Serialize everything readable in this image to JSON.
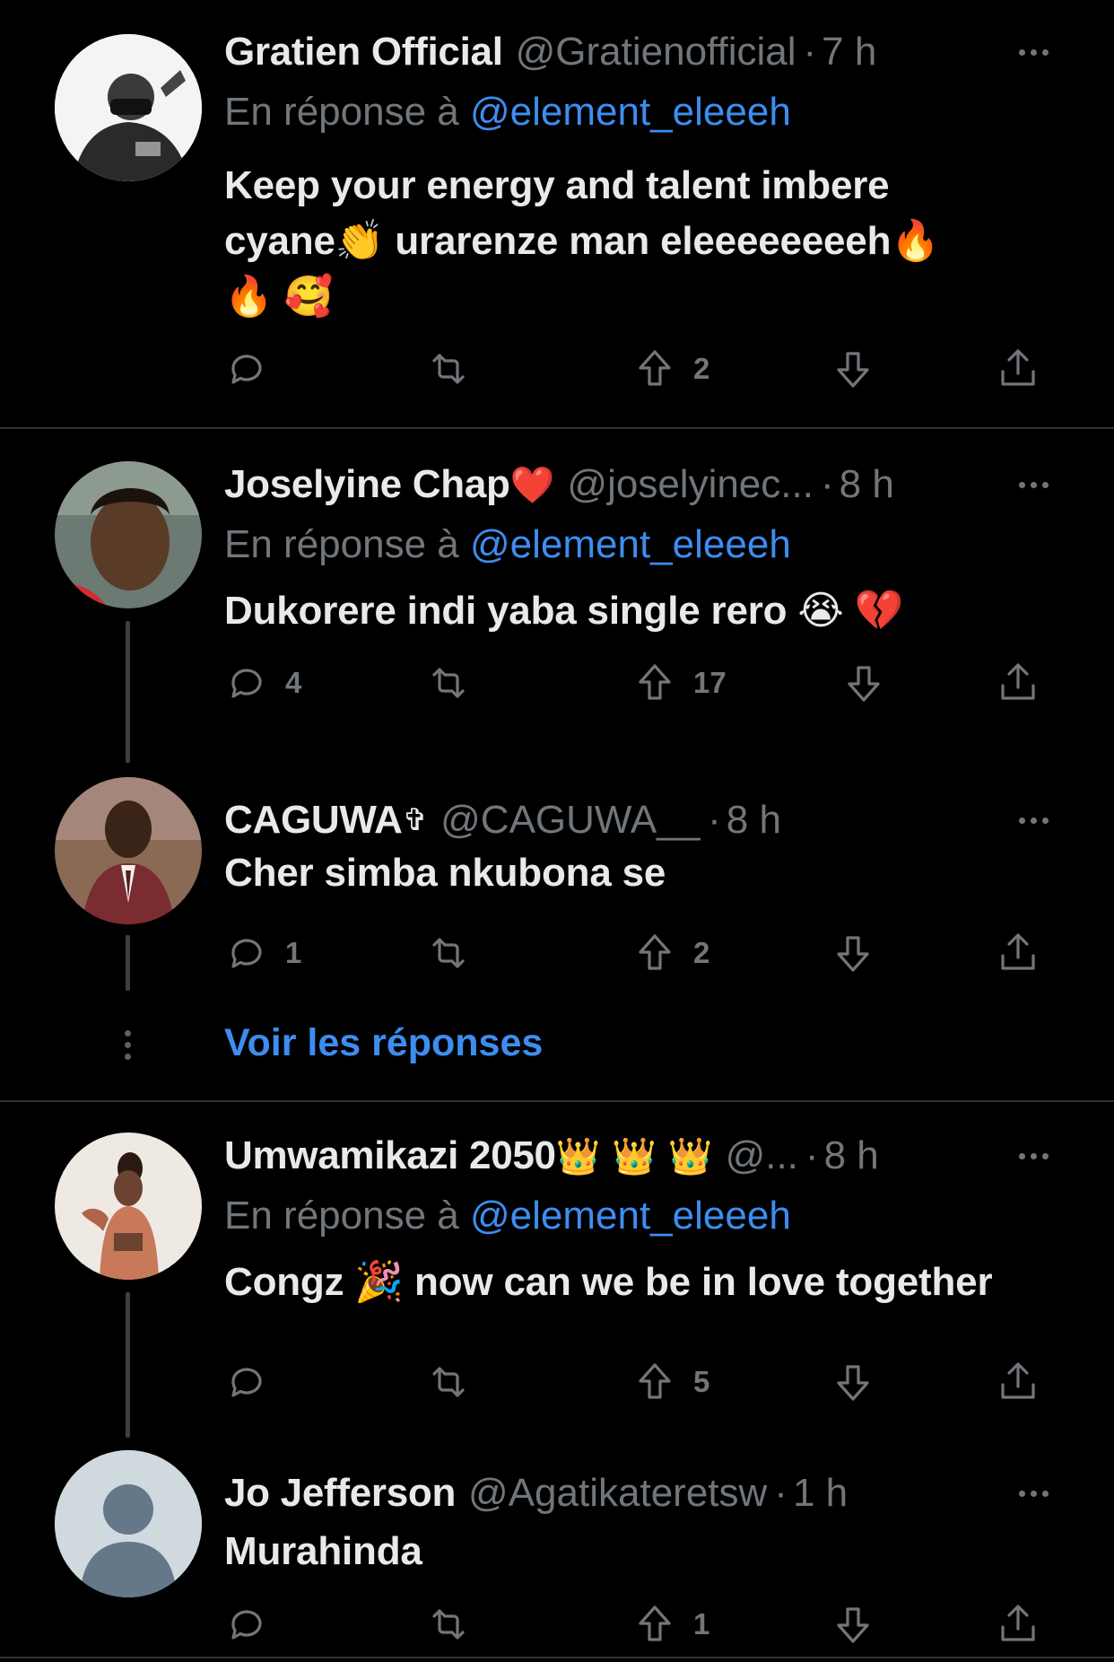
{
  "colors": {
    "background": "#000000",
    "text": "#e7e9ea",
    "muted": "#71767b",
    "link": "#3d8df0",
    "divider": "#2f3336"
  },
  "reply_prefix": "En réponse à",
  "show_replies_label": "Voir les réponses",
  "tweets": [
    {
      "name": "Gratien Official",
      "handle": "@Gratienofficial",
      "time": "7 h",
      "reply_to": "@element_eleeeh",
      "text_lines": [
        "Keep your energy and talent imbere",
        "cyane👏 urarenze man eleeeeeeeeh🔥",
        "🔥 🥰"
      ],
      "replies": "",
      "retweets": "",
      "upvotes": "2"
    },
    {
      "name": "Joselyine Chap",
      "name_emoji": "❤️",
      "handle": "@joselyinec...",
      "time": "8 h",
      "reply_to": "@element_eleeeh",
      "text_lines": [
        "Dukorere indi yaba single rero 😭 💔"
      ],
      "replies": "4",
      "retweets": "",
      "upvotes": "17"
    },
    {
      "name": "CAGUWA",
      "name_emoji": "✞",
      "handle": "@CAGUWA__",
      "time": "8 h",
      "text_lines": [
        "Cher simba nkubona se"
      ],
      "replies": "1",
      "retweets": "",
      "upvotes": "2"
    },
    {
      "name": "Umwamikazi 2050",
      "name_emoji": "👑 👑 👑",
      "handle": "@...",
      "time": "8 h",
      "reply_to": "@element_eleeeh",
      "text_lines": [
        "Congz 🎉 now can we be in love together"
      ],
      "replies": "",
      "retweets": "",
      "upvotes": "5"
    },
    {
      "name": "Jo Jefferson",
      "handle": "@Agatikateretsw",
      "time": "1 h",
      "text_lines": [
        "Murahinda"
      ],
      "replies": "",
      "retweets": "",
      "upvotes": "1"
    }
  ]
}
